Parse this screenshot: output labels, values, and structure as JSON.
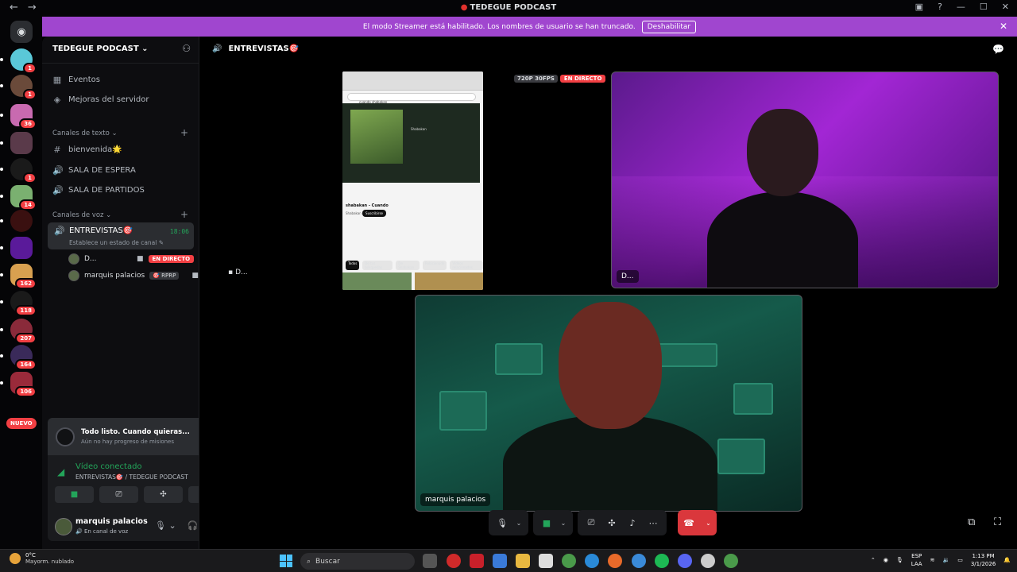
{
  "window": {
    "title": "TEDEGUE PODCAST",
    "back_label": "←",
    "forward_label": "→"
  },
  "banner": {
    "message": "El modo Streamer está habilitado. Los nombres de usuario se han truncado.",
    "disable_label": "Deshabilitar"
  },
  "rail": {
    "badges": [
      "1",
      "1",
      "36",
      "1",
      "1",
      "14",
      "162",
      "118",
      "207",
      "164",
      "106"
    ],
    "new_label": "NUEVO"
  },
  "sidebar": {
    "server_name": "TEDEGUE PODCAST",
    "items": [
      {
        "label": "Eventos",
        "icon": "calendar-icon"
      },
      {
        "label": "Mejoras del servidor",
        "icon": "boost-icon"
      }
    ],
    "text_category": "Canales de texto",
    "text_channels": [
      {
        "label": "bienvenida🌟",
        "icon": "hash-icon"
      },
      {
        "label": "SALA DE ESPERA",
        "icon": "speaker-icon"
      },
      {
        "label": "SALA DE PARTIDOS",
        "icon": "speaker-icon"
      }
    ],
    "voice_category": "Canales de voz",
    "active_voice": {
      "label": "ENTREVISTAS🎯",
      "status": "Establece un estado de canal",
      "timer": "18:06"
    },
    "voice_users": [
      {
        "name": "D...",
        "badge": "EN DIRECTO"
      },
      {
        "name": "marquis palacios",
        "badge": "🎯 RPRP"
      }
    ]
  },
  "quest": {
    "title": "Todo listo. Cuando quieras...",
    "subtitle": "Aún no hay progreso de misiones"
  },
  "voice_connection": {
    "status": "Vídeo conectado",
    "channel": "ENTREVISTAS🎯 / TEDEGUE PODCAST"
  },
  "user": {
    "name": "marquis palacios",
    "status": "En canal de voz"
  },
  "main": {
    "channel_title": "ENTREVISTAS🎯",
    "resolution_badge": "720P 30FPS",
    "live_badge": "EN DIRECTO",
    "tile_d_name": "D...",
    "tile_m_name": "marquis palacios",
    "placeholder_name": "D..."
  },
  "browser_preview": {
    "search_text": "cuando shabakan",
    "video_title": "shabakan - Cuando",
    "channel": "Shabakan",
    "subscribe_label": "Suscribirse",
    "pills": [
      "Todos",
      "De tus búsquedas",
      "De Shabakan",
      "Relacionado",
      "Vídeos relacionados"
    ]
  },
  "taskbar": {
    "temp": "0°C",
    "weather": "Mayorm. nublado",
    "search_placeholder": "Buscar",
    "lang1": "ESP",
    "lang2": "LAA",
    "time": "1:13 PM",
    "date": "3/1/2026"
  },
  "colors": {
    "banner": "#a046cf",
    "green": "#23a55a",
    "red": "#f23f43"
  }
}
